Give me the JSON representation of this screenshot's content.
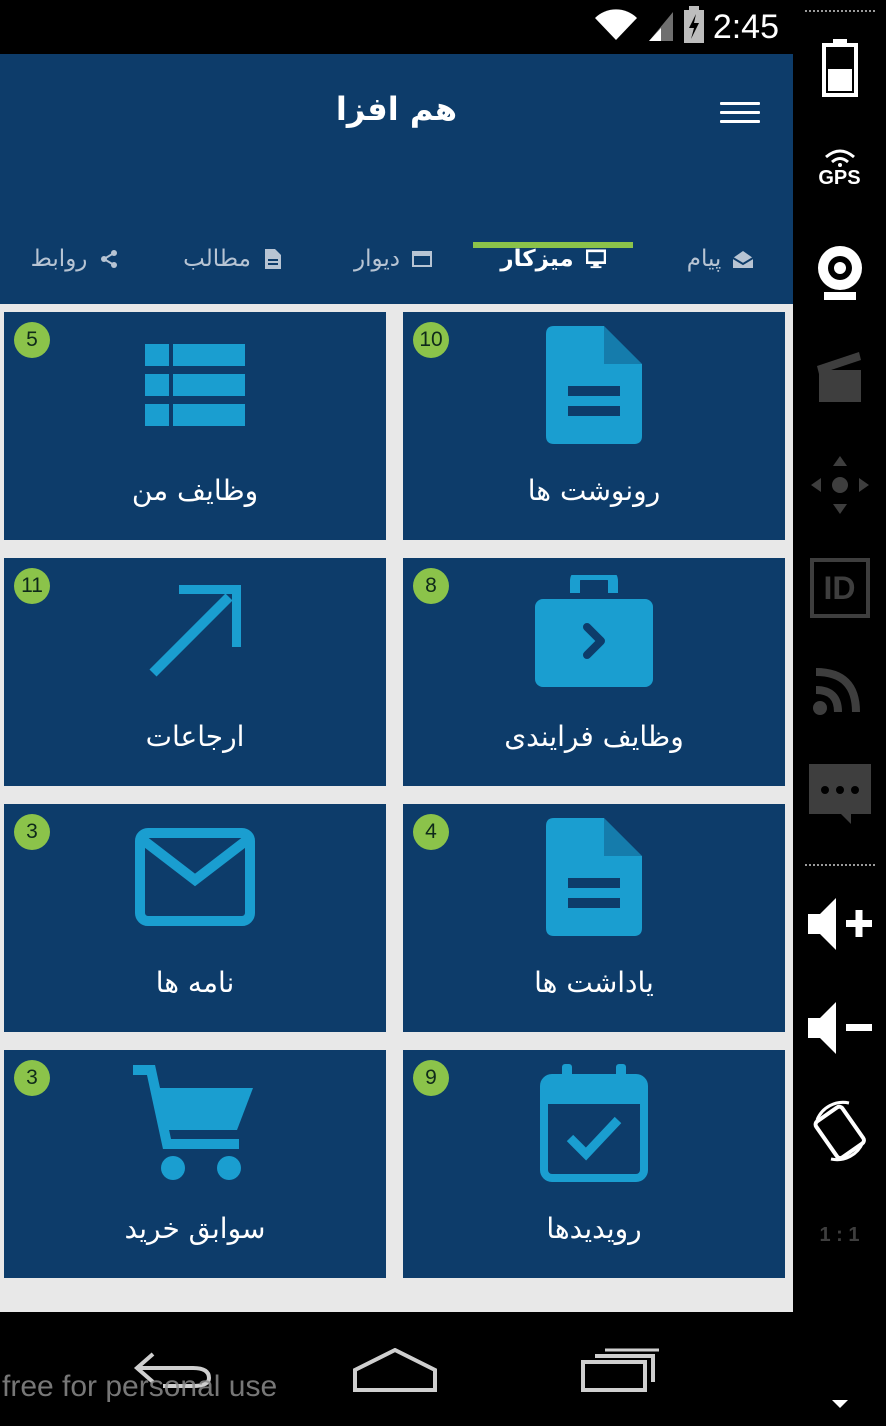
{
  "status_bar": {
    "time": "2:45"
  },
  "header": {
    "title": "هم افزا"
  },
  "tabs": [
    {
      "label": "پیام",
      "icon": "envelope-open-icon"
    },
    {
      "label": "میزکار",
      "icon": "monitor-icon",
      "active": true
    },
    {
      "label": "دیوار",
      "icon": "window-icon"
    },
    {
      "label": "مطالب",
      "icon": "document-icon"
    },
    {
      "label": "روابط",
      "icon": "share-icon"
    }
  ],
  "tiles": [
    {
      "label": "رونوشت ها",
      "badge": "10",
      "icon": "document-icon"
    },
    {
      "label": "وظایف من",
      "badge": "5",
      "icon": "list-icon"
    },
    {
      "label": "وظایف فرایندی",
      "badge": "8",
      "icon": "briefcase-icon"
    },
    {
      "label": "ارجاعات",
      "badge": "11",
      "icon": "arrow-icon"
    },
    {
      "label": "یاداشت ها",
      "badge": "4",
      "icon": "document-icon"
    },
    {
      "label": "نامه ها",
      "badge": "3",
      "icon": "envelope-icon"
    },
    {
      "label": "رویدیدها",
      "badge": "9",
      "icon": "calendar-check-icon"
    },
    {
      "label": "سوابق خرید",
      "badge": "3",
      "icon": "cart-icon"
    }
  ],
  "side_panel": {
    "gps_label": "GPS",
    "id_label": "ID",
    "scale_label": "1 : 1"
  },
  "watermark": "free for personal use",
  "colors": {
    "primary": "#0d3c6a",
    "accent": "#8bc34a",
    "icon": "#1a9ed0",
    "background": "#e8e8e8"
  }
}
